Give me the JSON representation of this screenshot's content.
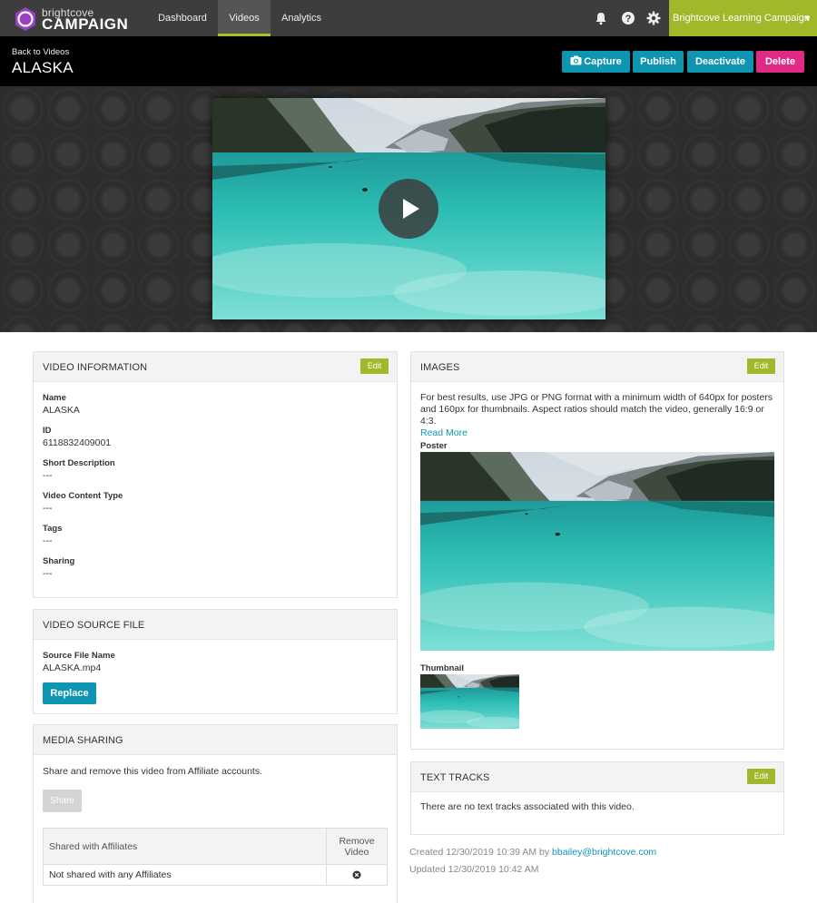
{
  "brand": {
    "small": "brightcove",
    "big": "CAMPAIGN",
    "accent": "#a1b82b",
    "action_blue": "#0e95b1",
    "delete_pink": "#e02a86"
  },
  "nav": {
    "tabs": [
      {
        "label": "Dashboard",
        "active": false
      },
      {
        "label": "Videos",
        "active": true
      },
      {
        "label": "Analytics",
        "active": false
      }
    ],
    "icons": [
      "bell-icon",
      "help-icon",
      "gear-icon"
    ],
    "account": "Brightcove Learning Campaign"
  },
  "header": {
    "back": "Back to Videos",
    "title": "ALASKA",
    "buttons": {
      "capture": "Capture",
      "publish": "Publish",
      "deactivate": "Deactivate",
      "delete": "Delete"
    }
  },
  "video_info": {
    "title": "VIDEO INFORMATION",
    "edit": "Edit",
    "fields": [
      {
        "label": "Name",
        "value": "ALASKA"
      },
      {
        "label": "ID",
        "value": "6118832409001"
      },
      {
        "label": "Short Description",
        "value": "---"
      },
      {
        "label": "Video Content Type",
        "value": "---"
      },
      {
        "label": "Tags",
        "value": "---"
      },
      {
        "label": "Sharing",
        "value": "---"
      }
    ]
  },
  "source_file": {
    "title": "VIDEO SOURCE FILE",
    "label": "Source File Name",
    "value": "ALASKA.mp4",
    "replace": "Replace"
  },
  "media_sharing": {
    "title": "MEDIA SHARING",
    "desc": "Share and remove this video from Affiliate accounts.",
    "share": "Share",
    "col1": "Shared with Affiliates",
    "col2": "Remove Video",
    "row": "Not shared with any Affiliates"
  },
  "images": {
    "title": "IMAGES",
    "edit": "Edit",
    "desc": "For best results, use JPG or PNG format with a minimum width of 640px for posters and 160px for thumbnails. Aspect ratios should match the video, generally 16:9 or 4:3.",
    "read_more": "Read More",
    "poster_label": "Poster",
    "thumb_label": "Thumbnail"
  },
  "text_tracks": {
    "title": "TEXT TRACKS",
    "edit": "Edit",
    "desc": "There are no text tracks associated with this video."
  },
  "meta": {
    "created_prefix": "Created 12/30/2019 10:39 AM by",
    "created_by": "bbailey@brightcove.com",
    "updated": "Updated 12/30/2019 10:42 AM"
  }
}
